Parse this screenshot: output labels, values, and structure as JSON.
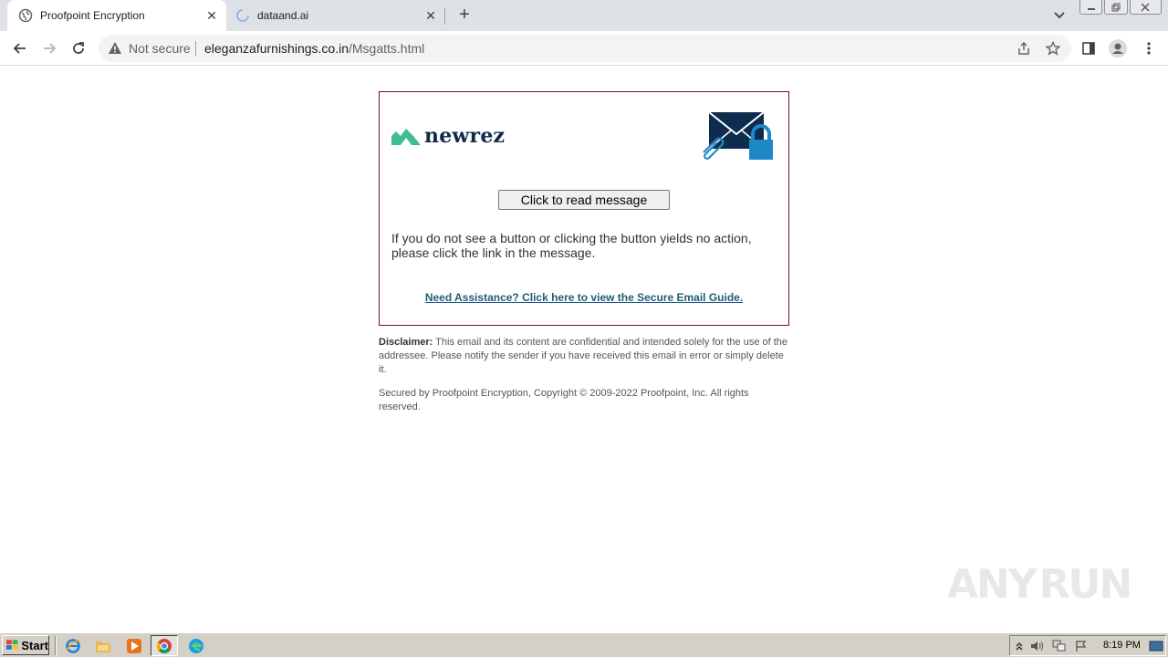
{
  "browser": {
    "tabs": [
      {
        "title": "Proofpoint Encryption",
        "active": true,
        "favicon": "globe-icon"
      },
      {
        "title": "dataand.ai",
        "active": false,
        "favicon": "loading-spinner-icon"
      }
    ],
    "new_tab_label": "+",
    "address_bar": {
      "security_label": "Not secure",
      "url_host": "eleganzafurnishings.co.in",
      "url_path": "/Msgatts.html"
    }
  },
  "page": {
    "logo_text": "newrez",
    "read_button_label": "Click to read message",
    "instruction_text": "If you do not see a button or clicking the button yields no action, please click the link in the message.",
    "assistance_link": "Need Assistance? Click here to view the Secure Email Guide.",
    "disclaimer_label": "Disclaimer:",
    "disclaimer_text": "This email and its content are confidential and intended solely for the use of the addressee. Please notify the sender if you have received this email in error or simply delete it.",
    "copyright_text": "Secured by Proofpoint Encryption, Copyright © 2009-2022 Proofpoint, Inc. All rights reserved."
  },
  "watermark": {
    "left": "ANY",
    "right": "RUN"
  },
  "taskbar": {
    "start_label": "Start",
    "clock": "8:19 PM"
  },
  "colors": {
    "card_border": "#6d1533",
    "logo_green": "#3fbf8f",
    "logo_navy": "#13294b",
    "link_blue": "#1f5c7a",
    "envelope_navy": "#0e2d4e",
    "lock_blue": "#1e88c7"
  }
}
